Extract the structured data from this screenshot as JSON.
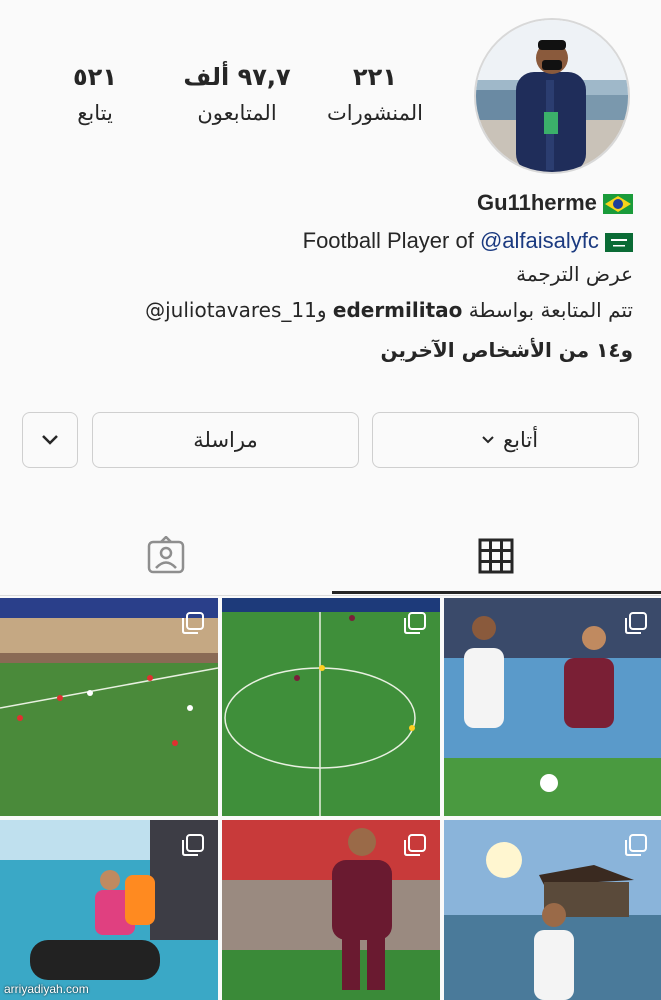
{
  "profile": {
    "stats": [
      {
        "value": "٢٢١",
        "label": "المنشورات"
      },
      {
        "value": "٩٧,٧ ألف",
        "label": "المتابعون"
      },
      {
        "value": "٥٢١",
        "label": "يتابع"
      }
    ],
    "username": "Gu11herme",
    "bio_prefix": "Football Player of ",
    "bio_mention": "@alfaisalyfc",
    "translate": "عرض الترجمة",
    "followed_by_prefix": "تتم المتابعة بواسطة ",
    "followed_by_user1": "edermilitao",
    "followed_by_and": " و",
    "followed_by_user2": "juliotavares_11@",
    "followed_by_others": "و١٤ من الأشخاص الآخرين"
  },
  "actions": {
    "follow_label": "أتابع",
    "message_label": "مراسلة"
  },
  "tabs": [
    {
      "icon": "grid-icon",
      "active": true
    },
    {
      "icon": "tagged-icon",
      "active": false
    }
  ],
  "grid": {
    "posts": [
      {
        "type": "multi",
        "subject": "stadium-wide-shot"
      },
      {
        "type": "multi",
        "subject": "tv-broadcast-pitch"
      },
      {
        "type": "multi",
        "subject": "player-kicking-ball"
      },
      {
        "type": "multi",
        "subject": "family-jetski"
      },
      {
        "type": "multi",
        "subject": "player-running"
      },
      {
        "type": "multi",
        "subject": "sunset-sea"
      }
    ]
  },
  "watermark": "arriyadiyah.com",
  "colors": {
    "accent_mention": "#1b3a80",
    "text": "#262626",
    "border": "#cfcfcf",
    "background": "#fafafa"
  }
}
